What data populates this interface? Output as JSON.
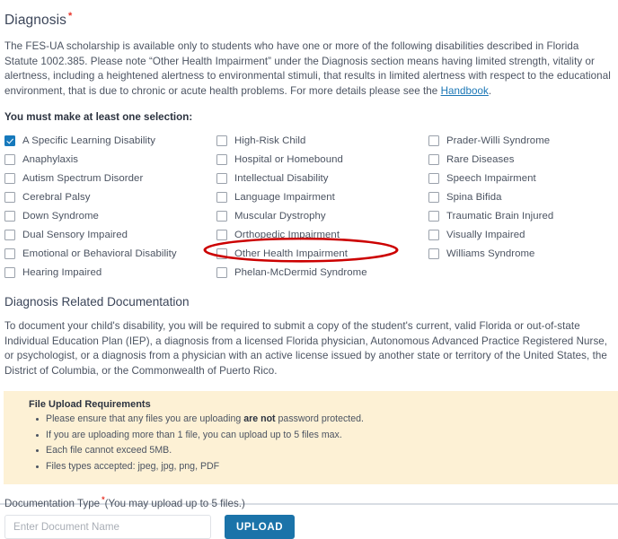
{
  "diagnosis": {
    "title": "Diagnosis",
    "required_marker": "*",
    "intro_part1": "The FES-UA scholarship is available only to students who have one or more of the following disabilities described in Florida Statute 1002.385. Please note “Other Health Impairment” under the Diagnosis section means having limited strength, vitality or alertness, including a heightened alertness to environmental stimuli, that results in limited alertness with respect to the educational environment, that is due to chronic or acute health problems. For more details please see the ",
    "handbook_link": "Handbook",
    "intro_part2": ".",
    "selection_prompt": "You must make at least one selection:",
    "columns": [
      {
        "items": [
          {
            "label": "A Specific Learning Disability",
            "checked": true
          },
          {
            "label": "Anaphylaxis",
            "checked": false
          },
          {
            "label": "Autism Spectrum Disorder",
            "checked": false
          },
          {
            "label": "Cerebral Palsy",
            "checked": false
          },
          {
            "label": "Down Syndrome",
            "checked": false
          },
          {
            "label": "Dual Sensory Impaired",
            "checked": false
          },
          {
            "label": "Emotional or Behavioral Disability",
            "checked": false
          },
          {
            "label": "Hearing Impaired",
            "checked": false
          }
        ]
      },
      {
        "items": [
          {
            "label": "High-Risk Child",
            "checked": false
          },
          {
            "label": "Hospital or Homebound",
            "checked": false
          },
          {
            "label": "Intellectual Disability",
            "checked": false
          },
          {
            "label": "Language Impairment",
            "checked": false
          },
          {
            "label": "Muscular Dystrophy",
            "checked": false
          },
          {
            "label": "Orthopedic Impairment",
            "checked": false
          },
          {
            "label": "Other Health Impairment",
            "checked": false,
            "highlighted": true
          },
          {
            "label": "Phelan-McDermid Syndrome",
            "checked": false
          }
        ]
      },
      {
        "items": [
          {
            "label": "Prader-Willi Syndrome",
            "checked": false
          },
          {
            "label": "Rare Diseases",
            "checked": false
          },
          {
            "label": "Speech Impairment",
            "checked": false
          },
          {
            "label": "Spina Bifida",
            "checked": false
          },
          {
            "label": "Traumatic Brain Injured",
            "checked": false
          },
          {
            "label": "Visually Impaired",
            "checked": false
          },
          {
            "label": "Williams Syndrome",
            "checked": false
          }
        ]
      }
    ]
  },
  "documentation": {
    "title": "Diagnosis Related Documentation",
    "paragraph": "To document your child's disability, you will be required to submit a copy of the student's current, valid Florida or out-of-state Individual Education Plan (IEP), a diagnosis from a licensed Florida physician, Autonomous Advanced Practice Registered Nurse, or psychologist, or a diagnosis from a physician with an active license issued by another state or territory of the United States, the District of Columbia, or the Commonwealth of Puerto Rico."
  },
  "callout": {
    "title": "File Upload Requirements",
    "items": [
      {
        "before": "Please ensure that any files you are uploading ",
        "bold": "are not",
        "after": " password protected."
      },
      {
        "before": "If you are uploading more than 1 file, you can upload up to 5 files max.",
        "bold": "",
        "after": ""
      },
      {
        "before": "Each file cannot exceed 5MB.",
        "bold": "",
        "after": ""
      },
      {
        "before": "Files types accepted: jpeg, jpg, png, PDF",
        "bold": "",
        "after": ""
      }
    ]
  },
  "upload": {
    "label_main": "Documentation Type",
    "required_marker": "*",
    "label_note": "(You may upload up to 5 files.)",
    "input_placeholder": "Enter Document Name",
    "input_value": "",
    "button_label": "UPLOAD"
  },
  "annotation": {
    "type": "red-ellipse",
    "target": "Other Health Impairment",
    "color": "#cc0000"
  },
  "colors": {
    "accent_blue": "#1679bc",
    "button_blue": "#1b73a9",
    "link_blue": "#1a76b5",
    "required_red": "#e8342a",
    "callout_bg": "#fdf1d5",
    "annotation_red": "#cc0000"
  }
}
